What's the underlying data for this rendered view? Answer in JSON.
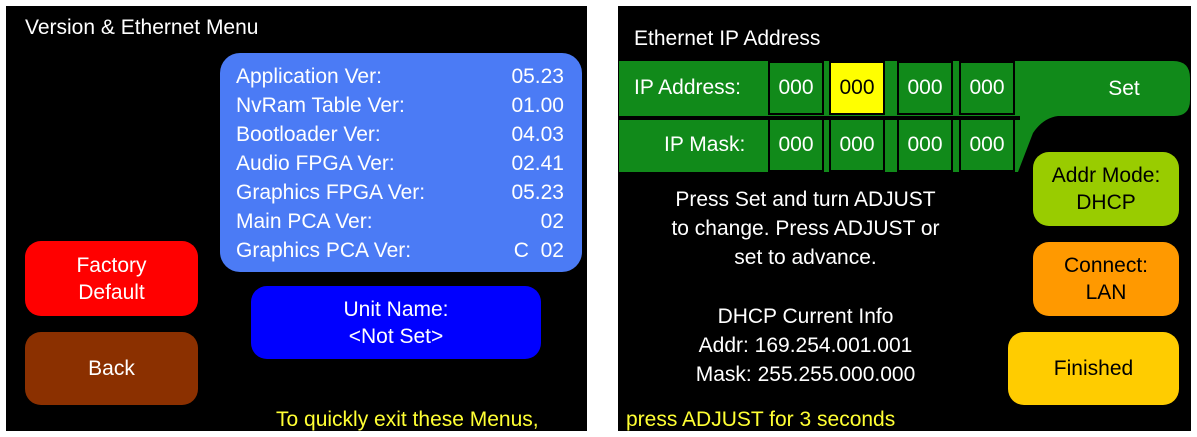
{
  "left": {
    "title": "Version & Ethernet Menu",
    "versions": [
      {
        "label": "Application Ver:",
        "value": "05.23"
      },
      {
        "label": "NvRam Table Ver:",
        "value": "01.00"
      },
      {
        "label": "Bootloader Ver:",
        "value": "04.03"
      },
      {
        "label": "Audio FPGA Ver:",
        "value": "02.41"
      },
      {
        "label": "Graphics FPGA Ver:",
        "value": "05.23"
      },
      {
        "label": "Main PCA Ver:",
        "value": "02"
      },
      {
        "label": "Graphics PCA Ver:",
        "value": "C  02"
      }
    ],
    "factory_default_label": "Factory\nDefault",
    "back_label": "Back",
    "unit_name_label": "Unit Name:\n<Not Set>",
    "footer": "To quickly exit these Menus,"
  },
  "right": {
    "title": "Ethernet IP Address",
    "ip_address_label": "IP Address:",
    "ip_address": [
      "000",
      "000",
      "000",
      "000"
    ],
    "ip_mask_label": "IP Mask:",
    "ip_mask": [
      "000",
      "000",
      "000",
      "000"
    ],
    "set_label": "Set",
    "instructions": "Press Set and turn ADJUST\nto change. Press ADJUST or\nset to advance.",
    "dhcp_title": "DHCP Current Info",
    "dhcp_addr": "Addr: 169.254.001.001",
    "dhcp_mask": "Mask: 255.255.000.000",
    "addr_mode_label": "Addr Mode:\nDHCP",
    "connect_label": "Connect:\nLAN",
    "finished_label": "Finished",
    "footer": "press ADJUST for 3 seconds"
  },
  "colors": {
    "version_panel": "#4b7bf5",
    "factory_default": "#ff0000",
    "back": "#8b3000",
    "unit_name": "#0000ff",
    "ip_green": "#118a1a",
    "selected_octet": "#ffff00",
    "addr_mode": "#99cc00",
    "connect": "#ff9900",
    "finished": "#ffcc00",
    "footer_text": "#ffff33"
  }
}
